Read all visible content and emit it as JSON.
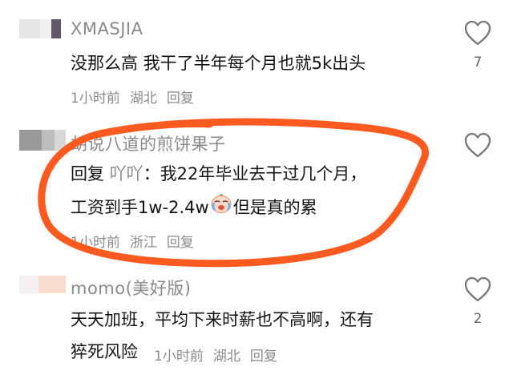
{
  "comments": [
    {
      "author": "XMASJIA",
      "text": "没那么高 我干了半年每个月也就5k出头",
      "time": "1小时前",
      "location": "湖北",
      "reply": "回复",
      "likes": "7"
    },
    {
      "author": "胡说八道的煎饼果子",
      "reply_prefix": "回复",
      "reply_to": "吖吖",
      "line1": "：我22年毕业去干过几个月，",
      "line2a": "工资到手1w-2.4w",
      "line2b": "但是真的累",
      "time": "1小时前",
      "location": "浙江",
      "reply": "回复"
    },
    {
      "author": "momo(美好版)",
      "line1": "天天加班，平均下来时薪也不高啊，还有",
      "line2": "猝死风险",
      "time": "1小时前",
      "location": "湖北",
      "reply": "回复",
      "likes": "2"
    }
  ],
  "icons": {
    "like": "heart-outline-icon",
    "emoji": "crying-face-emoji"
  },
  "colors": {
    "circle": "#ff5a1f",
    "meta": "#8a8a8a",
    "text": "#141414"
  }
}
